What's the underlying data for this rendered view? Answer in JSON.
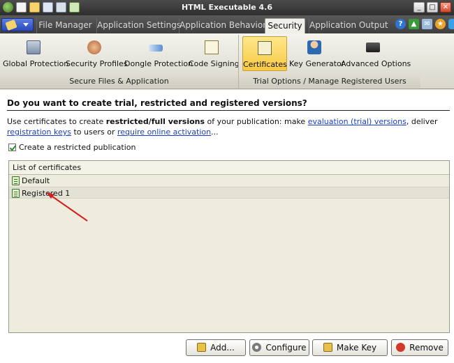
{
  "window": {
    "title": "HTML Executable 4.6"
  },
  "tabs": [
    {
      "label": "File Manager"
    },
    {
      "label": "Application Settings"
    },
    {
      "label": "Application Behavior"
    },
    {
      "label": "Security"
    },
    {
      "label": "Application Output"
    }
  ],
  "ribbon": {
    "groups": [
      {
        "label": "Secure Files & Application"
      },
      {
        "label": "Trial Options / Manage Registered Users"
      }
    ],
    "buttons": [
      {
        "label": "Global Protection"
      },
      {
        "label": "Security Profiles"
      },
      {
        "label": "Dongle Protection"
      },
      {
        "label": "Code Signing"
      },
      {
        "label": "Certificates"
      },
      {
        "label": "Key Generator"
      },
      {
        "label": "Advanced Options"
      }
    ]
  },
  "content": {
    "heading": "Do you want to create trial, restricted and registered versions?",
    "desc_pre": "Use certificates to create ",
    "desc_bold": "restricted/full versions",
    "desc_mid": " of your publication: make ",
    "link_evaluation": "evaluation (trial) versions",
    "desc_mid2": ", deliver ",
    "link_keys": "registration keys",
    "desc_mid3": " to users or ",
    "link_activation": "require online activation",
    "desc_end": "...",
    "checkbox_label": "Create a restricted publication",
    "list_header": "List of certificates",
    "certificates": [
      "Default",
      "Registered 1"
    ]
  },
  "buttons": {
    "add": "Add...",
    "configure": "Configure",
    "make_key": "Make Key",
    "remove": "Remove"
  }
}
